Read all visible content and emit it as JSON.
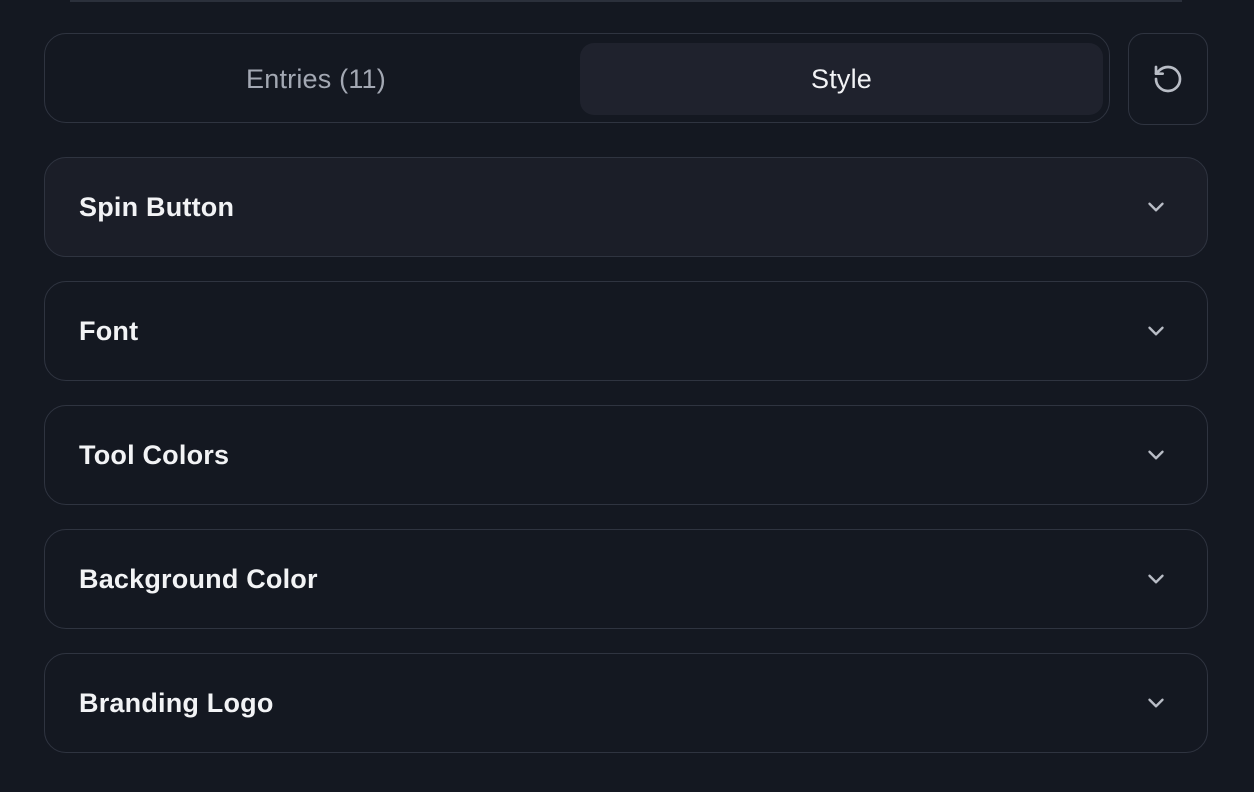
{
  "tabs": {
    "entries_label": "Entries (11)",
    "style_label": "Style",
    "active": "style"
  },
  "reset_button": {
    "icon": "rotate-ccw-icon"
  },
  "sections": [
    {
      "title": "Spin Button",
      "icon": "chevron-down-icon",
      "expanded": false
    },
    {
      "title": "Font",
      "icon": "chevron-down-icon",
      "expanded": false
    },
    {
      "title": "Tool Colors",
      "icon": "chevron-down-icon",
      "expanded": false
    },
    {
      "title": "Background Color",
      "icon": "chevron-down-icon",
      "expanded": false
    },
    {
      "title": "Branding Logo",
      "icon": "chevron-down-icon",
      "expanded": false
    }
  ],
  "colors": {
    "background": "#141821",
    "border": "#2f3440",
    "active_tab": "#1f222d",
    "text_primary": "#f2f3f5",
    "text_muted": "#a3a8b3"
  }
}
